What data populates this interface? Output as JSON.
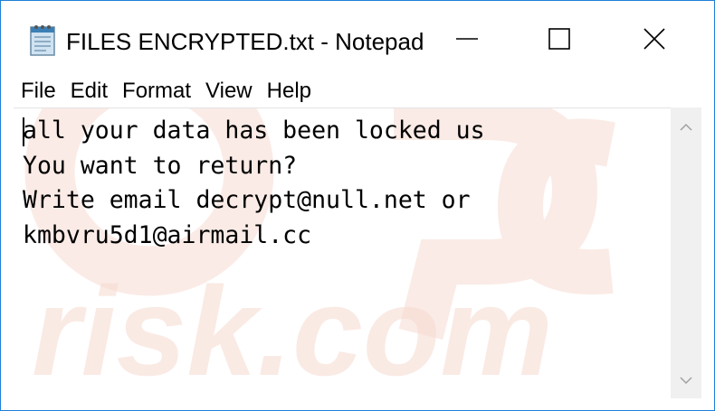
{
  "window": {
    "title": "FILES ENCRYPTED.txt - Notepad",
    "border_color": "#1e7fd8"
  },
  "titlebar": {
    "app_icon": "notepad-icon",
    "minimize_icon": "minimize-icon",
    "maximize_icon": "maximize-icon",
    "close_icon": "close-icon"
  },
  "menu": {
    "items": [
      {
        "label": "File"
      },
      {
        "label": "Edit"
      },
      {
        "label": "Format"
      },
      {
        "label": "View"
      },
      {
        "label": "Help"
      }
    ]
  },
  "editor": {
    "lines": [
      "all your data has been locked us",
      "You want to return?",
      "Write email decrypt@null.net or",
      "kmbvru5d1@airmail.cc"
    ],
    "watermark_text": "risk.com",
    "watermark_color": "#f7d9cf"
  },
  "scrollbar": {
    "up_icon": "chevron-up-icon",
    "down_icon": "chevron-down-icon",
    "track_color": "#f0f0f0"
  }
}
